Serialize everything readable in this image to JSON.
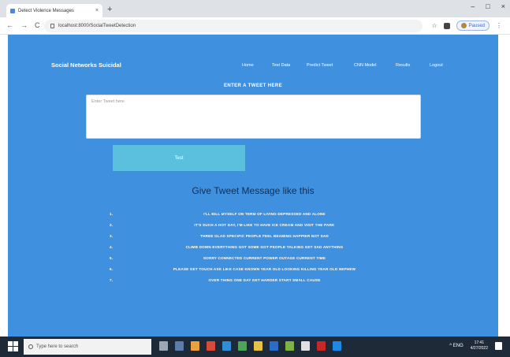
{
  "browser": {
    "tab_title": "Detect Violence Messages",
    "tab_close": "×",
    "new_tab": "+",
    "window_controls": [
      "–",
      "□",
      "×"
    ],
    "nav_buttons": [
      "←",
      "→",
      "C"
    ],
    "address": "localhost:8000/SocialTweetDetection",
    "profile_label": "Paused"
  },
  "site": {
    "brand": "Social Networks Suicidal",
    "nav": [
      "Home",
      "Test Data",
      "Predict Tweet",
      "CNN Model",
      "Results",
      "Logout"
    ]
  },
  "form": {
    "title": "ENTER A TWEET HERE",
    "placeholder": "Enter Tweet here",
    "submit_label": "Test"
  },
  "examples": {
    "title": "Give Tweet Message like this",
    "items": [
      {
        "num": "1.",
        "text": "I'LL BILL MYSELF ON TERM OF LIVING DEPRESSED AND ALONE"
      },
      {
        "num": "2.",
        "text": "IT'S SUCH A HOT DAY, I'M LIKE TO HAVE ICE CREAM AND VISIT THE PARK"
      },
      {
        "num": "3.",
        "text": "THREE GLAD SPECIFIC PEOPLE FEEL BEAMING HAPPIER NOT SAD"
      },
      {
        "num": "4.",
        "text": "CLIMB DOWN EVERYTHING GOT SOME GOT PEOPLE TALKING GET SAD ANYTHING"
      },
      {
        "num": "5.",
        "text": "SORRY CONNECTED CURRENT POWER OUTAGE CURRENT TIME"
      },
      {
        "num": "6.",
        "text": "PLEASE GET TOUCH ASK LIKE CASE KNOWN YEAR OLD LOOKING KILLING YEAR OLD NEPHEW"
      },
      {
        "num": "7.",
        "text": "OVER THING ONE DAY GET HARDER START SMALL CAUSE"
      }
    ]
  },
  "taskbar": {
    "search_placeholder": "Type here to search",
    "tray_text": "^ ENG",
    "time": "17:41",
    "date": "4/27/2022",
    "icon_colors": [
      "#9aa7b4",
      "#5a7ea8",
      "#e9a23b",
      "#d94a3a",
      "#2f8fd6",
      "#4fa35a",
      "#e3c246",
      "#2d6cc6",
      "#7cb342",
      "#e0e0e0",
      "#c62828",
      "#1e88e5"
    ]
  },
  "colors": {
    "page_background": "#3f90df",
    "submit_button": "#5bc0de",
    "examples_title": "#0f2f57"
  }
}
